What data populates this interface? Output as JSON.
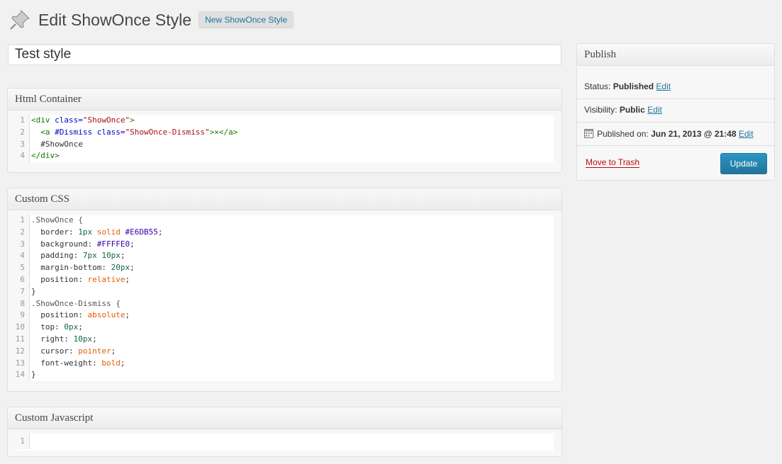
{
  "header": {
    "title": "Edit ShowOnce Style",
    "add_new": "New ShowOnce Style"
  },
  "post_title": {
    "value": "Test style"
  },
  "html_box": {
    "title": "Html Container",
    "lines": [
      {
        "n": "1"
      },
      {
        "n": "2"
      },
      {
        "n": "3"
      },
      {
        "n": "4"
      }
    ]
  },
  "css_box": {
    "title": "Custom CSS",
    "lines": [
      "1",
      "2",
      "3",
      "4",
      "5",
      "6",
      "7",
      "8",
      "9",
      "10",
      "11",
      "12",
      "13",
      "14"
    ]
  },
  "js_box": {
    "title": "Custom Javascript",
    "lines": [
      "1"
    ]
  },
  "publish": {
    "title": "Publish",
    "status_label": "Status:",
    "status_value": "Published",
    "visibility_label": "Visibility:",
    "visibility_value": "Public",
    "published_label": "Published on:",
    "published_value": "Jun 21, 2013 @ 21:48",
    "edit": "Edit",
    "trash": "Move to Trash",
    "update": "Update"
  },
  "code": {
    "html": {
      "l1": {
        "a": "<div ",
        "b": "class=",
        "c": "\"ShowOnce\"",
        "d": ">"
      },
      "l2": {
        "a": "<a ",
        "b": "#Dismiss class=",
        "c": "\"ShowOnce-Dismiss\"",
        "d": ">×</a>"
      },
      "l3": "#ShowOnce",
      "l4": "</div>"
    },
    "css": {
      "l1": ".ShowOnce {",
      "l2": {
        "p": "border:",
        "v1": "1px",
        "v2": "solid",
        "v3": "#E6DB55",
        "e": ";"
      },
      "l3": {
        "p": "background:",
        "v": "#FFFFE0",
        "e": ";"
      },
      "l4": {
        "p": "padding:",
        "v": "7px 10px",
        "e": ";"
      },
      "l5": {
        "p": "margin-bottom:",
        "v": "20px",
        "e": ";"
      },
      "l6": {
        "p": "position:",
        "v": "relative",
        "e": ";"
      },
      "l7": "}",
      "l8": ".ShowOnce-Dismiss {",
      "l9": {
        "p": "position:",
        "v": "absolute",
        "e": ";"
      },
      "l10": {
        "p": "top:",
        "v": "0px",
        "e": ";"
      },
      "l11": {
        "p": "right:",
        "v": "10px",
        "e": ";"
      },
      "l12": {
        "p": "cursor:",
        "v": "pointer",
        "e": ";"
      },
      "l13": {
        "p": "font-weight:",
        "v": "bold",
        "e": ";"
      },
      "l14": "}"
    }
  }
}
